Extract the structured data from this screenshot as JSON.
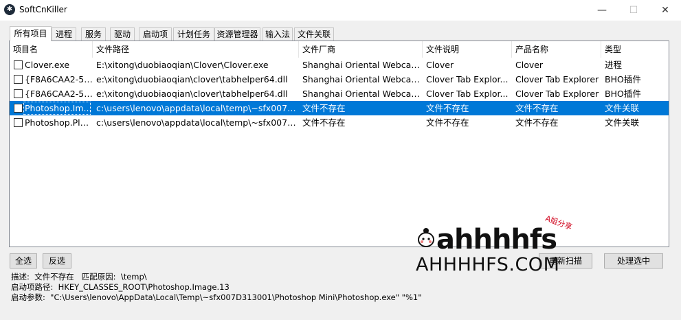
{
  "window": {
    "title": "SoftCnKiller",
    "minimize": "—",
    "maximize": "☐",
    "close": "✕"
  },
  "tabs": [
    {
      "label": "所有项目",
      "active": true
    },
    {
      "label": "进程"
    },
    {
      "label": "服务"
    },
    {
      "label": "驱动"
    },
    {
      "label": "启动项"
    },
    {
      "label": "计划任务"
    },
    {
      "label": "资源管理器"
    },
    {
      "label": "输入法"
    },
    {
      "label": "文件关联"
    }
  ],
  "table": {
    "columns": [
      "项目名",
      "文件路径",
      "文件厂商",
      "文件说明",
      "产品名称",
      "类型"
    ],
    "rows": [
      [
        "Clover.exe",
        "E:\\xitong\\duobiaoqian\\Clover\\Clover.exe",
        "Shanghai Oriental Webcast...",
        "Clover",
        "Clover",
        "进程"
      ],
      [
        "{F8A6CAA2-53...",
        "e:\\xitong\\duobiaoqian\\clover\\tabhelper64.dll",
        "Shanghai Oriental Webcast...",
        "Clover Tab Explor...",
        "Clover Tab Explorer",
        "BHO插件"
      ],
      [
        "{F8A6CAA2-53...",
        "e:\\xitong\\duobiaoqian\\clover\\tabhelper64.dll",
        "Shanghai Oriental Webcast...",
        "Clover Tab Explor...",
        "Clover Tab Explorer",
        "BHO插件"
      ],
      [
        "Photoshop.Im...",
        "c:\\users\\lenovo\\appdata\\local\\temp\\~sfx007d3...",
        "文件不存在",
        "文件不存在",
        "文件不存在",
        "文件关联"
      ],
      [
        "Photoshop.Plu...",
        "c:\\users\\lenovo\\appdata\\local\\temp\\~sfx007d3...",
        "文件不存在",
        "文件不存在",
        "文件不存在",
        "文件关联"
      ]
    ],
    "selected_row_index": 3
  },
  "buttons": {
    "select_all": "全选",
    "invert": "反选",
    "rescan": "重新扫描",
    "process_selected": "处理选中"
  },
  "details": {
    "description": "描述:  文件不存在   匹配原因:  \\temp\\",
    "startup_path": "启动项路径:  HKEY_CLASSES_ROOT\\Photoshop.Image.13",
    "startup_args": "启动参数:  \"C:\\Users\\lenovo\\AppData\\Local\\Temp\\~sfx007D313001\\Photoshop Mini\\Photoshop.exe\" \"%1\""
  },
  "watermark": {
    "main": "ahhhhfs",
    "sub": "AHHHHFS.COM",
    "tag": "A姐分享"
  },
  "colors": {
    "selection": "#0078d7",
    "watermark_tag": "#d0021b"
  }
}
